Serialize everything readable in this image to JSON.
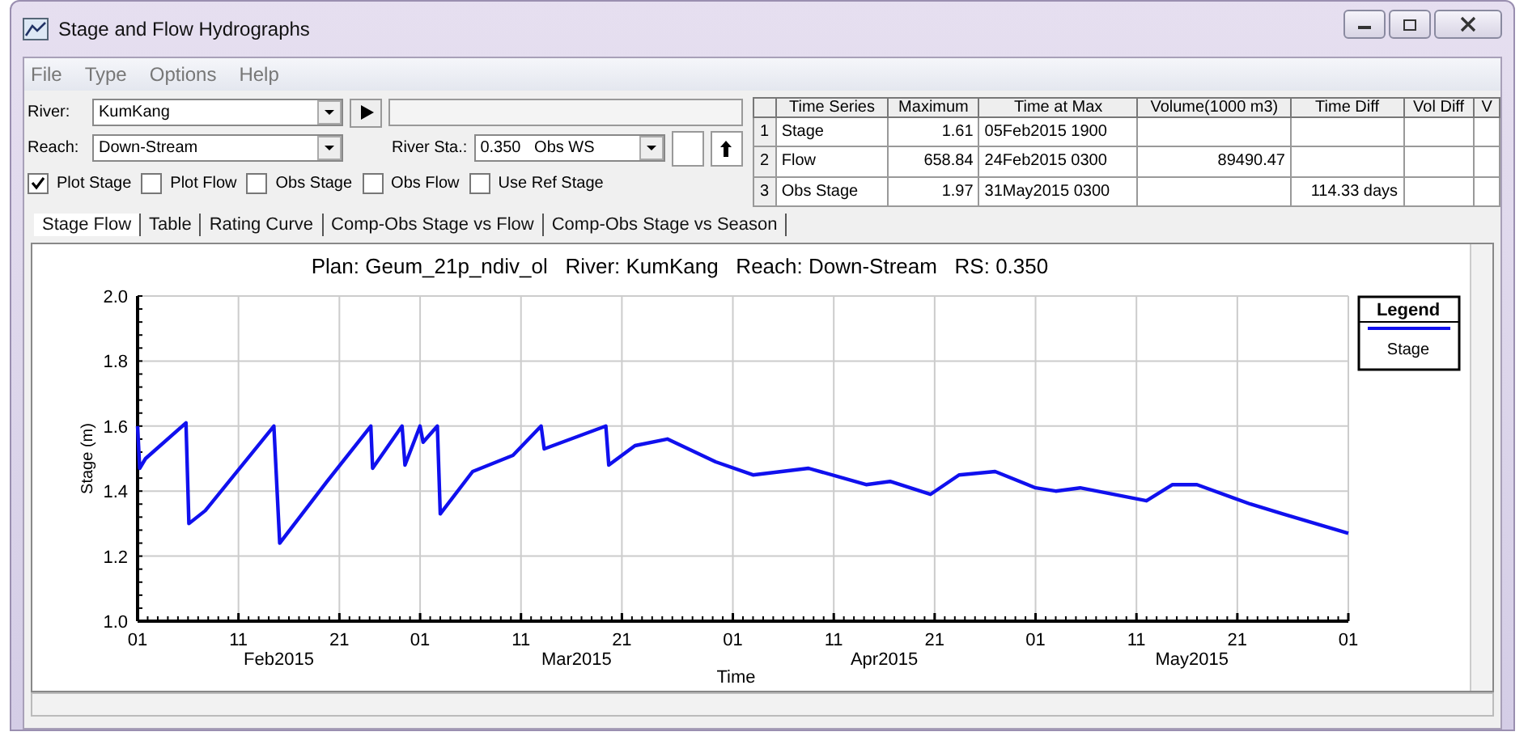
{
  "window": {
    "title": "Stage and Flow Hydrographs"
  },
  "menu": [
    "File",
    "Type",
    "Options",
    "Help"
  ],
  "river": {
    "label": "River:",
    "value": "KumKang"
  },
  "reach": {
    "label": "Reach:",
    "value": "Down-Stream"
  },
  "river_sta": {
    "label": "River Sta.:",
    "value": "0.350",
    "type": "Obs WS"
  },
  "checkboxes": [
    {
      "label": "Plot Stage",
      "checked": true
    },
    {
      "label": "Plot Flow",
      "checked": false
    },
    {
      "label": "Obs Stage",
      "checked": false
    },
    {
      "label": "Obs Flow",
      "checked": false
    },
    {
      "label": "Use Ref Stage",
      "checked": false
    }
  ],
  "table": {
    "columns": [
      "Time Series",
      "Maximum",
      "Time at Max",
      "Volume(1000 m3)",
      "Time Diff",
      "Vol Diff",
      "V"
    ],
    "rows": [
      {
        "num": "1",
        "cells": [
          "Stage",
          "1.61",
          "05Feb2015  1900",
          "",
          "",
          "",
          ""
        ]
      },
      {
        "num": "2",
        "cells": [
          "Flow",
          "658.84",
          "24Feb2015  0300",
          "89490.47",
          "",
          "",
          ""
        ]
      },
      {
        "num": "3",
        "cells": [
          "Obs Stage",
          "1.97",
          "31May2015  0300",
          "",
          "114.33 days",
          "",
          ""
        ]
      }
    ]
  },
  "tabs": [
    {
      "label": "Stage Flow",
      "selected": true
    },
    {
      "label": "Table",
      "selected": false
    },
    {
      "label": "Rating Curve",
      "selected": false
    },
    {
      "label": "Comp-Obs Stage vs Flow",
      "selected": false
    },
    {
      "label": "Comp-Obs Stage vs Season",
      "selected": false
    }
  ],
  "plot": {
    "legend_title": "Legend",
    "months": [
      "Feb2015",
      "Mar2015",
      "Apr2015",
      "May2015"
    ],
    "chart_data": {
      "type": "line",
      "title": "Plan: Geum_21p_ndiv_ol   River: KumKang   Reach: Down-Stream   RS: 0.350",
      "xlabel": "Time",
      "ylabel": "Stage (m)",
      "xlim": [
        "2015-02-01T00:00",
        "2015-06-01T00:00"
      ],
      "grid": true,
      "ylim": [
        1.0,
        2.0
      ],
      "xticks": [
        {
          "value": "2015-02-01T00:00",
          "label": "01"
        },
        {
          "value": "2015-02-11T00:00",
          "label": "11"
        },
        {
          "value": "2015-02-21T00:00",
          "label": "21"
        },
        {
          "value": "2015-03-01T00:00",
          "label": "01"
        },
        {
          "value": "2015-03-11T00:00",
          "label": "11"
        },
        {
          "value": "2015-03-21T00:00",
          "label": "21"
        },
        {
          "value": "2015-04-01T00:00",
          "label": "01"
        },
        {
          "value": "2015-04-11T00:00",
          "label": "11"
        },
        {
          "value": "2015-04-21T00:00",
          "label": "21"
        },
        {
          "value": "2015-05-01T00:00",
          "label": "01"
        },
        {
          "value": "2015-05-11T00:00",
          "label": "11"
        },
        {
          "value": "2015-05-21T00:00",
          "label": "21"
        },
        {
          "value": "2015-06-01T00:00",
          "label": "01"
        }
      ],
      "yticks": [
        {
          "value": 1.0,
          "label": "1.0"
        },
        {
          "value": 1.2,
          "label": "1.2"
        },
        {
          "value": 1.4,
          "label": "1.4"
        },
        {
          "value": 1.6,
          "label": "1.6"
        },
        {
          "value": 1.8,
          "label": "1.8"
        },
        {
          "value": 2.0,
          "label": "2.0"
        }
      ],
      "x": [
        "2015-02-01T00:00",
        "2015-02-01T05:00",
        "2015-02-01T19:00",
        "2015-02-05T19:00",
        "2015-02-06T02:00",
        "2015-02-07T17:00",
        "2015-02-14T12:00",
        "2015-02-15T02:00",
        "2015-02-19T19:00",
        "2015-02-24T03:00",
        "2015-02-24T07:00",
        "2015-02-27T05:00",
        "2015-02-27T12:00",
        "2015-03-01T00:00",
        "2015-03-01T07:00",
        "2015-03-02T17:00",
        "2015-03-03T00:00",
        "2015-03-06T05:00",
        "2015-03-10T05:00",
        "2015-03-13T00:00",
        "2015-03-13T07:00",
        "2015-03-19T10:00",
        "2015-03-19T17:00",
        "2015-03-22T07:00",
        "2015-03-25T12:00",
        "2015-03-30T07:00",
        "2015-04-03T00:00",
        "2015-04-08T12:00",
        "2015-04-14T05:00",
        "2015-04-16T14:00",
        "2015-04-20T14:00",
        "2015-04-23T10:00",
        "2015-04-27T00:00",
        "2015-05-01T00:00",
        "2015-05-03T00:00",
        "2015-05-05T10:00",
        "2015-05-12T00:00",
        "2015-05-14T14:00",
        "2015-05-17T00:00",
        "2015-05-22T07:00",
        "2015-05-25T12:00",
        "2015-06-01T00:00"
      ],
      "series": [
        {
          "name": "Stage",
          "color": "#1010ee",
          "values": [
            1.6,
            1.47,
            1.5,
            1.61,
            1.3,
            1.34,
            1.6,
            1.24,
            1.43,
            1.6,
            1.47,
            1.6,
            1.48,
            1.6,
            1.55,
            1.6,
            1.33,
            1.46,
            1.51,
            1.6,
            1.53,
            1.6,
            1.48,
            1.54,
            1.56,
            1.49,
            1.45,
            1.47,
            1.42,
            1.43,
            1.39,
            1.45,
            1.46,
            1.41,
            1.4,
            1.41,
            1.37,
            1.42,
            1.42,
            1.36,
            1.33,
            1.27
          ]
        }
      ]
    }
  }
}
